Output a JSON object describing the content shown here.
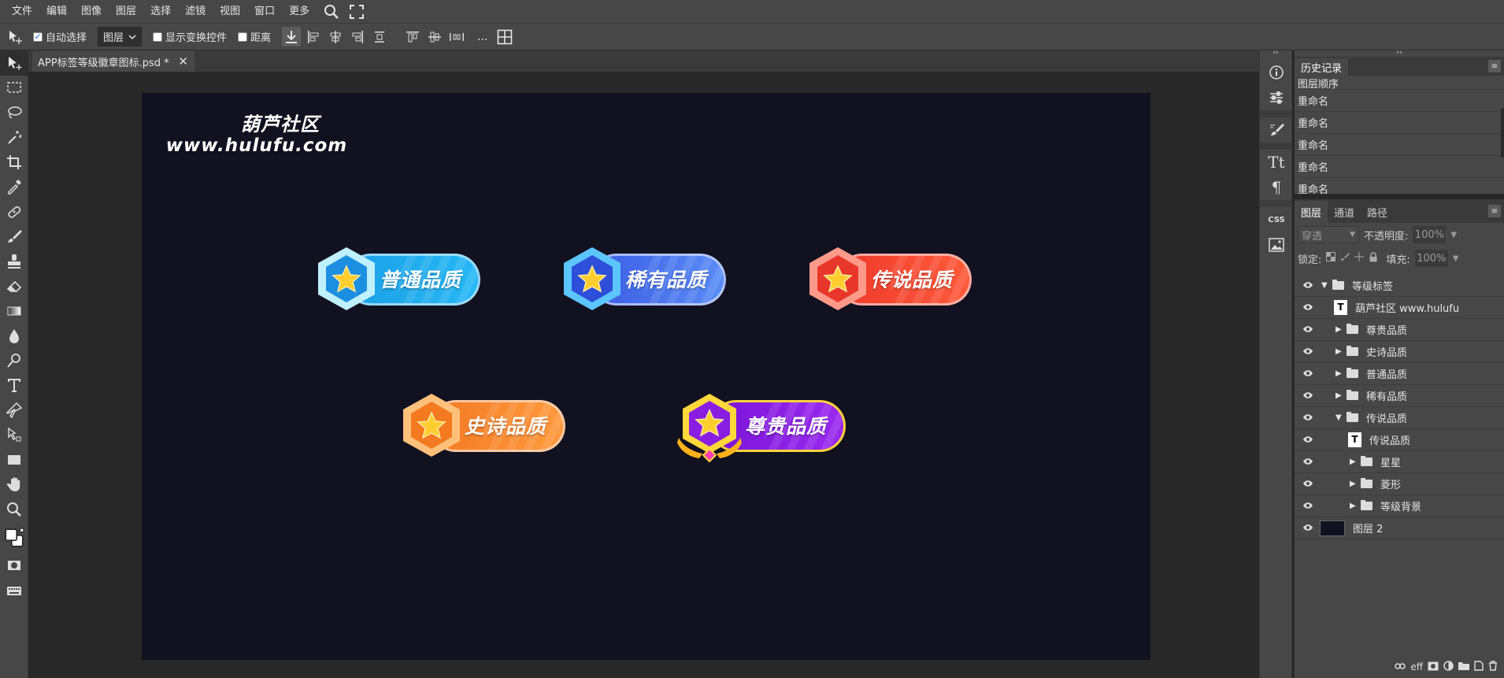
{
  "menu": {
    "items": [
      "文件",
      "编辑",
      "图像",
      "图层",
      "选择",
      "滤镜",
      "视图",
      "窗口",
      "更多"
    ]
  },
  "options": {
    "auto_select_label": "自动选择",
    "auto_select_checked": true,
    "target_select": "图层",
    "show_transform_label": "显示变换控件",
    "distance_label": "距离",
    "more": "..."
  },
  "document": {
    "tab_title": "APP标签等级徽章图标.psd *"
  },
  "canvas": {
    "background": "#121120",
    "watermark_line1": "葫芦社区",
    "watermark_line2": "www.hulufu.com",
    "badges": [
      {
        "label": "普通品质",
        "color": "#1c9ee0"
      },
      {
        "label": "稀有品质",
        "color": "#3f66e8"
      },
      {
        "label": "传说品质",
        "color": "#f0432f"
      },
      {
        "label": "史诗品质",
        "color": "#f5822a"
      },
      {
        "label": "尊贵品质",
        "color": "#8a1ee0"
      }
    ]
  },
  "history": {
    "tabs": [
      "历史记录"
    ],
    "rows": [
      "图层顺序",
      "重命名",
      "重命名",
      "重命名",
      "重命名",
      "重命名"
    ]
  },
  "layers_panel": {
    "tabs": [
      "图层",
      "通道",
      "路径"
    ],
    "blend_mode": "穿透",
    "opacity_label": "不透明度:",
    "opacity_value": "100%",
    "lock_label": "锁定:",
    "fill_label": "填充:",
    "fill_value": "100%",
    "layers": [
      {
        "name": "等级标签",
        "kind": "folder",
        "expanded": true
      },
      {
        "name": "葫芦社区 www.hulufu",
        "kind": "text"
      },
      {
        "name": "尊贵品质",
        "kind": "folder",
        "expanded": false
      },
      {
        "name": "史诗品质",
        "kind": "folder",
        "expanded": false
      },
      {
        "name": "普通品质",
        "kind": "folder",
        "expanded": false
      },
      {
        "name": "稀有品质",
        "kind": "folder",
        "expanded": false
      },
      {
        "name": "传说品质",
        "kind": "folder",
        "expanded": true
      },
      {
        "name": "传说品质",
        "kind": "text"
      },
      {
        "name": "星星",
        "kind": "folder",
        "expanded": false
      },
      {
        "name": "菱形",
        "kind": "folder",
        "expanded": false
      },
      {
        "name": "等级背景",
        "kind": "folder",
        "expanded": false
      },
      {
        "name": "图层 2",
        "kind": "image"
      }
    ],
    "footer_fx": "eff"
  }
}
